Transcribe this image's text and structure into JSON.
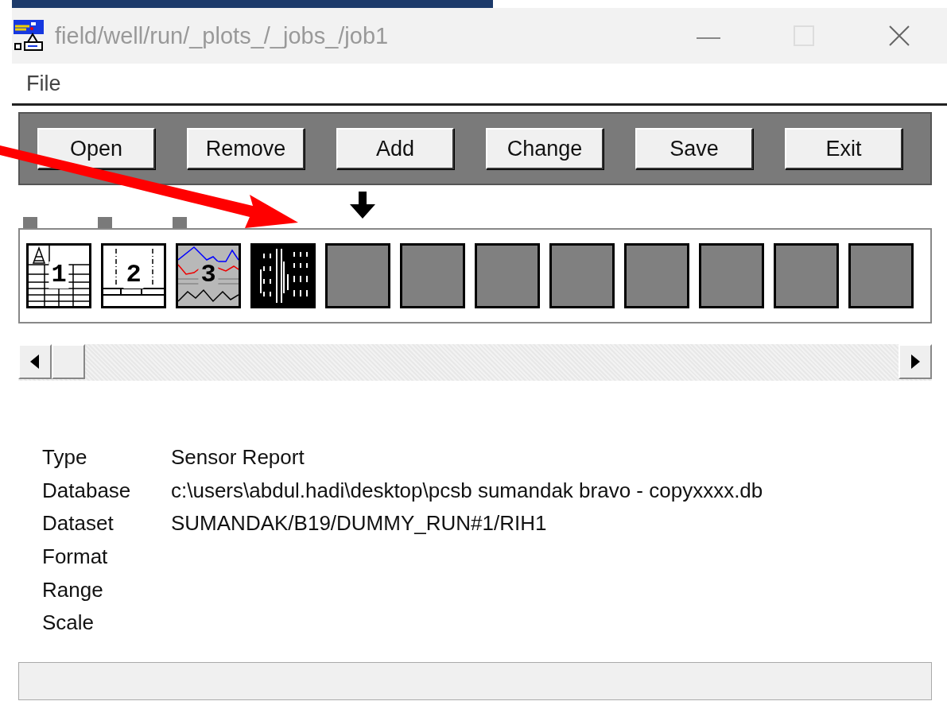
{
  "window": {
    "title": "field/well/run/_plots_/_jobs_/job1",
    "active": false
  },
  "menu": [
    {
      "label": "File"
    }
  ],
  "toolbar": [
    "Open",
    "Remove",
    "Add",
    "Change",
    "Save",
    "Exit"
  ],
  "slots": [
    {
      "kind": "table",
      "label": "1",
      "marked": true,
      "pointer": false
    },
    {
      "kind": "track",
      "label": "2",
      "marked": true,
      "pointer": false
    },
    {
      "kind": "curves",
      "label": "3",
      "marked": true,
      "pointer": false
    },
    {
      "kind": "image",
      "marked": false,
      "pointer": false
    },
    {
      "kind": "empty",
      "marked": false,
      "pointer": true
    },
    {
      "kind": "empty",
      "marked": false,
      "pointer": false
    },
    {
      "kind": "empty",
      "marked": false,
      "pointer": false
    },
    {
      "kind": "empty",
      "marked": false,
      "pointer": false
    },
    {
      "kind": "empty",
      "marked": false,
      "pointer": false
    },
    {
      "kind": "empty",
      "marked": false,
      "pointer": false
    },
    {
      "kind": "empty",
      "marked": false,
      "pointer": false
    },
    {
      "kind": "empty",
      "marked": false,
      "pointer": false
    }
  ],
  "details": [
    {
      "label": "Type",
      "value": "Sensor Report"
    },
    {
      "label": "Database",
      "value": "c:\\users\\abdul.hadi\\desktop\\pcsb sumandak bravo - copyxxxx.db"
    },
    {
      "label": "Dataset",
      "value": "SUMANDAK/B19/DUMMY_RUN#1/RIH1"
    },
    {
      "label": "Format"
    },
    {
      "label": "Range"
    },
    {
      "label": "Scale"
    }
  ]
}
